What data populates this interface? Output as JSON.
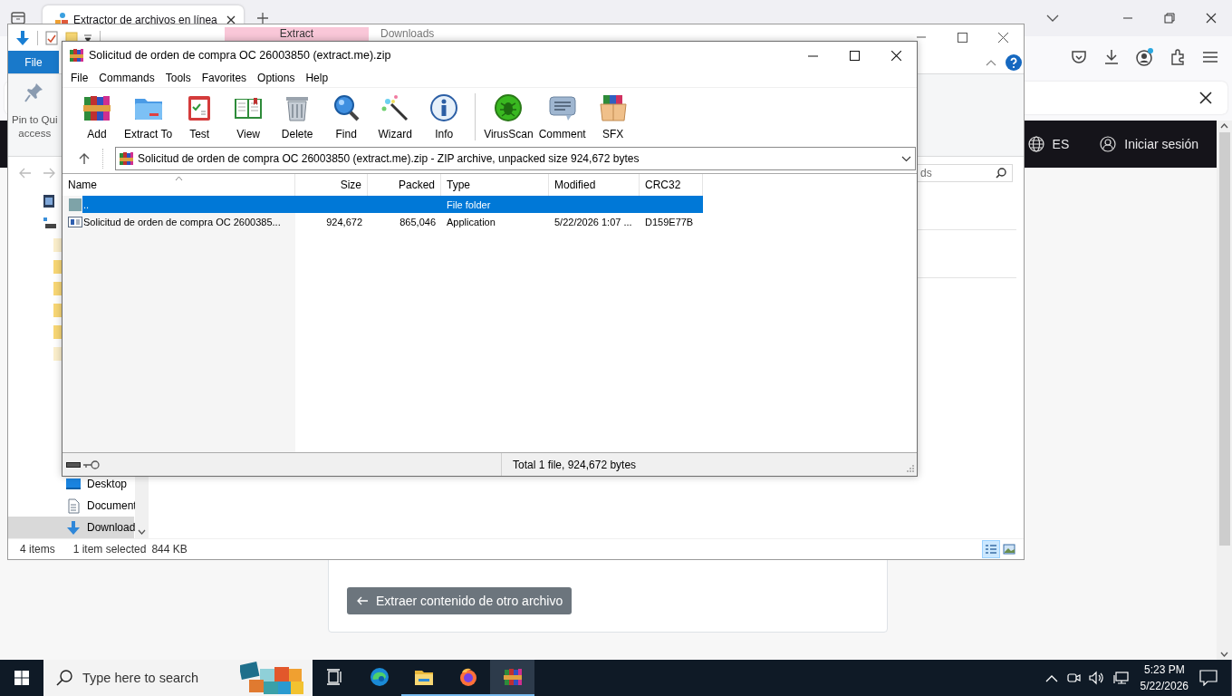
{
  "browser": {
    "tab": {
      "title": "Extractor de archivos en línea",
      "selected": true
    },
    "site_header": {
      "language": "ES",
      "login": "Iniciar sesión"
    },
    "page": {
      "back_button": "Extraer contenido de otro archivo"
    }
  },
  "explorer": {
    "contextual_tab": "Extract",
    "title": "Downloads",
    "file_tab": "File",
    "pin_button": {
      "line_1": "Pin to Qui",
      "line_2": "access"
    },
    "search": {
      "placeholder": "ds"
    },
    "nav_items": [
      {
        "label": "Desktop",
        "selected": false
      },
      {
        "label": "Document",
        "selected": false
      },
      {
        "label": "Download",
        "selected": true
      }
    ],
    "status_bar": {
      "item_count": "4 items",
      "selection": "1 item selected",
      "selection_size": "844 KB"
    },
    "view_buttons": [
      {
        "selected": true
      },
      {
        "selected": false
      }
    ]
  },
  "winrar": {
    "title": "Solicitud de orden de compra OC 26003850 (extract.me).zip",
    "menu": [
      "File",
      "Commands",
      "Tools",
      "Favorites",
      "Options",
      "Help"
    ],
    "toolbar_groups": [
      {
        "buttons": [
          "Add",
          "Extract To",
          "Test",
          "View",
          "Delete",
          "Find",
          "Wizard",
          "Info"
        ]
      },
      {
        "buttons": [
          "VirusScan",
          "Comment",
          "SFX"
        ]
      }
    ],
    "address": "Solicitud de orden de compra OC 26003850 (extract.me).zip - ZIP archive, unpacked size 924,672 bytes",
    "columns": [
      "Name",
      "Size",
      "Packed",
      "Type",
      "Modified",
      "CRC32"
    ],
    "rows": [
      {
        "name": "..",
        "type": "File folder",
        "selected": true
      },
      {
        "name": "Solicitud de orden de compra OC 2600385...",
        "size": "924,672",
        "packed": "865,046",
        "type": "Application",
        "modified": "5/22/2026 1:07 ...",
        "crc32": "D159E77B",
        "selected": false
      }
    ],
    "status": "Total 1 file, 924,672 bytes"
  },
  "taskbar": {
    "search": {
      "placeholder": "Type here to search"
    },
    "apps": [
      {
        "running": false,
        "selected": false
      },
      {
        "running": false,
        "selected": false
      },
      {
        "running": true,
        "selected": false
      },
      {
        "running": true,
        "selected": false
      },
      {
        "running": true,
        "selected": true
      }
    ],
    "clock": {
      "time": "5:23 PM",
      "date": "5/22/2026"
    }
  }
}
